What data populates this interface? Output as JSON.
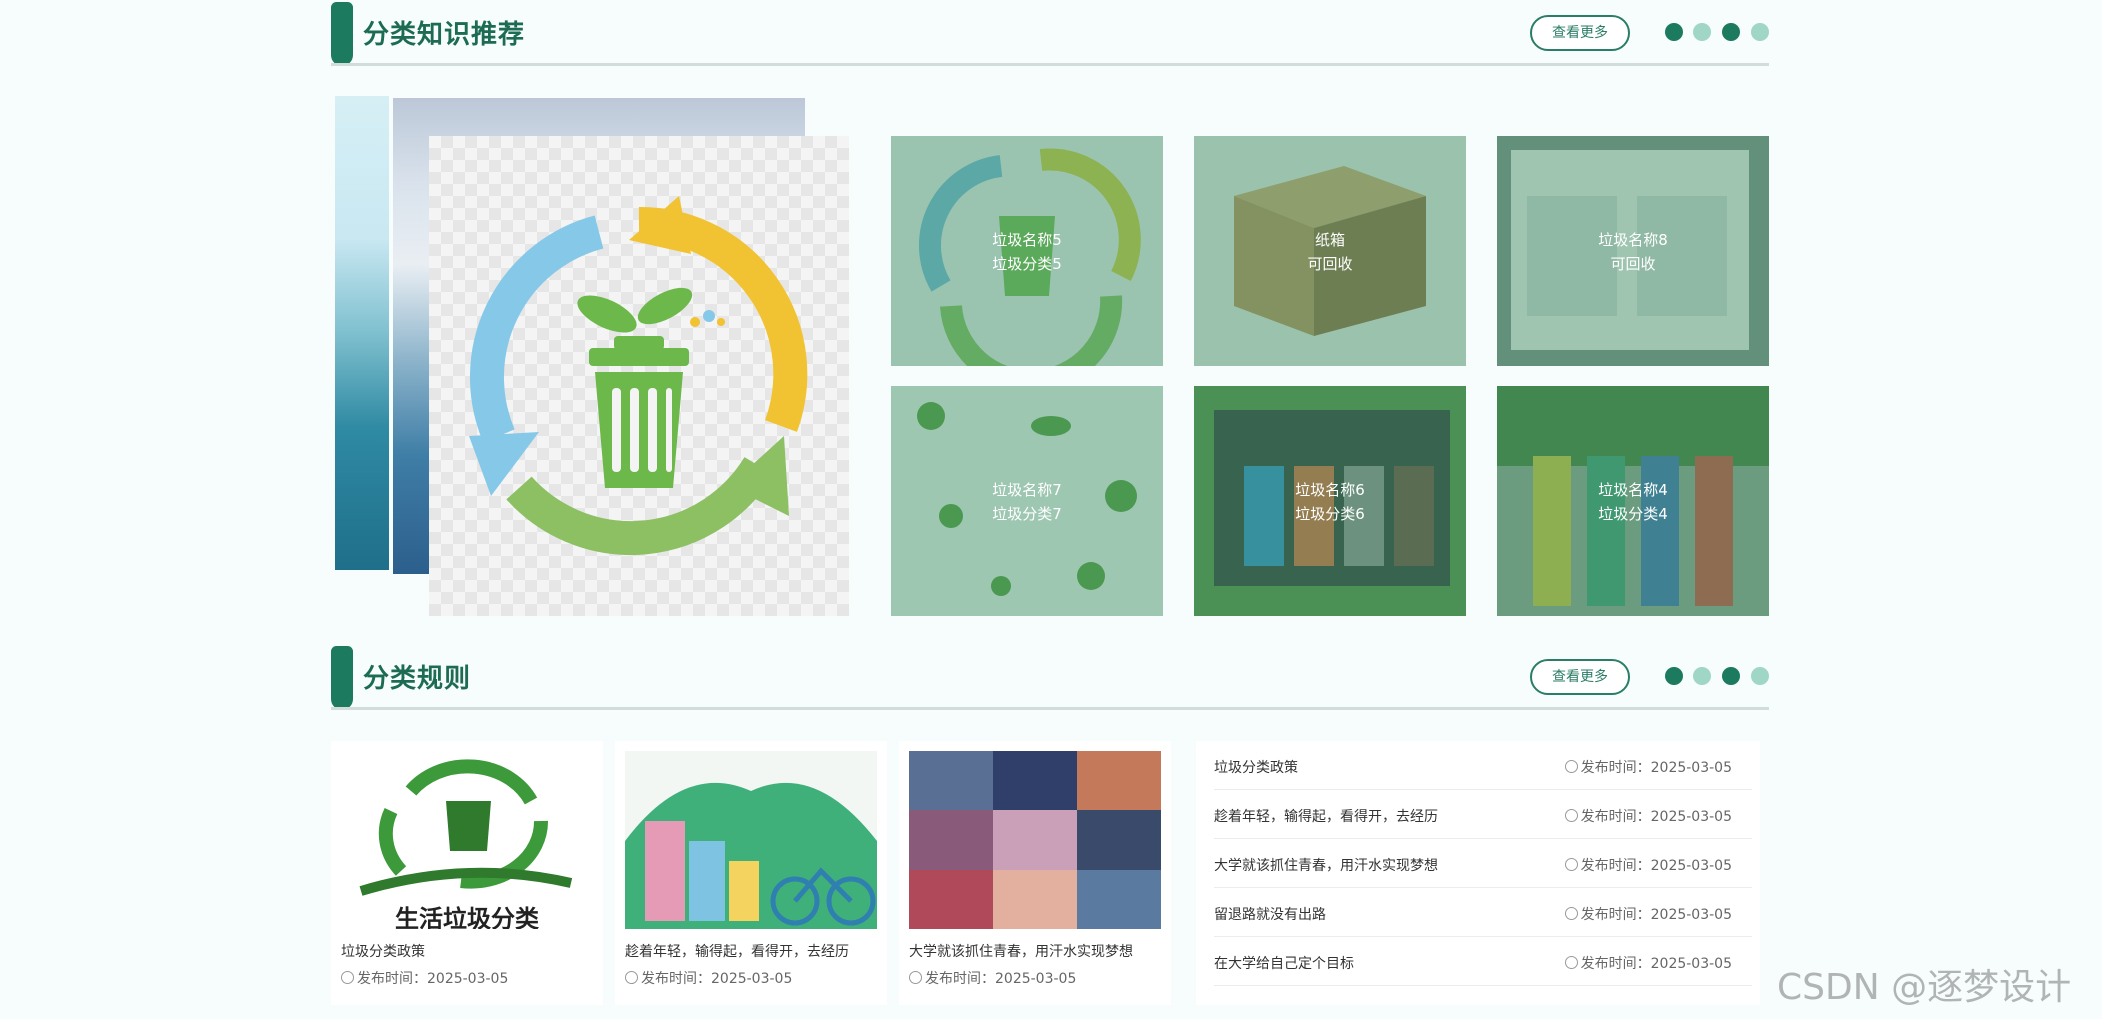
{
  "section_recommend": {
    "title": "分类知识推荐",
    "more_label": "查看更多",
    "cards": [
      {
        "name": "垃圾名称5",
        "category": "垃圾分类5"
      },
      {
        "name": "纸箱",
        "category": "可回收"
      },
      {
        "name": "垃圾名称8",
        "category": "可回收"
      },
      {
        "name": "垃圾名称7",
        "category": "垃圾分类7"
      },
      {
        "name": "垃圾名称6",
        "category": "垃圾分类6"
      },
      {
        "name": "垃圾名称4",
        "category": "垃圾分类4"
      }
    ]
  },
  "section_rules": {
    "title": "分类规则",
    "more_label": "查看更多",
    "image_caption": "生活垃圾分类",
    "cards": [
      {
        "title": "垃圾分类政策",
        "date": "发布时间：2025-03-05"
      },
      {
        "title": "趁着年轻，输得起，看得开，去经历",
        "date": "发布时间：2025-03-05"
      },
      {
        "title": "大学就该抓住青春，用汗水实现梦想",
        "date": "发布时间：2025-03-05"
      }
    ],
    "list": [
      {
        "title": "垃圾分类政策",
        "date": "发布时间：2025-03-05"
      },
      {
        "title": "趁着年轻，输得起，看得开，去经历",
        "date": "发布时间：2025-03-05"
      },
      {
        "title": "大学就该抓住青春，用汗水实现梦想",
        "date": "发布时间：2025-03-05"
      },
      {
        "title": "留退路就没有出路",
        "date": "发布时间：2025-03-05"
      },
      {
        "title": "在大学给自己定个目标",
        "date": "发布时间：2025-03-05"
      }
    ]
  },
  "colors": {
    "accent": "#1c7a5e",
    "dot_dark": "#1c7a5e",
    "dot_light": "#9fd6c6",
    "overlay": "#5aa07e"
  },
  "watermark": "CSDN @逐梦设计"
}
